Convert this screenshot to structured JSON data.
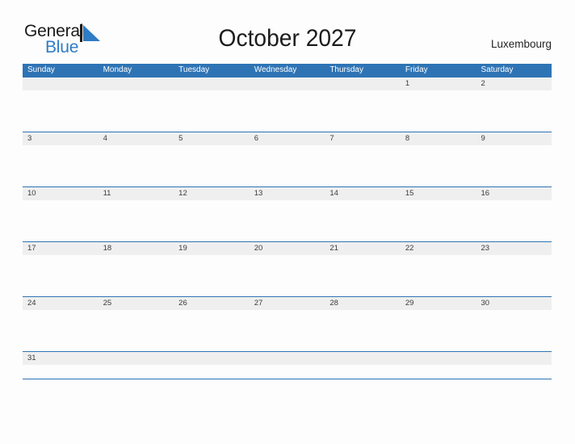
{
  "brand": {
    "name_line1": "General",
    "name_line2": "Blue",
    "triangle_icon": "triangle-right-icon",
    "color_primary": "#2e7cc4",
    "color_dark": "#1a1a1a"
  },
  "header": {
    "title": "October 2027",
    "locale": "Luxembourg"
  },
  "theme": {
    "header_blue": "#2e74b5",
    "date_strip_gray": "#efefef",
    "page_background": "#fdfdfd",
    "date_text": "#3a3a3a",
    "dow_text": "#ffffff"
  },
  "calendar": {
    "month": "October",
    "year": "2027",
    "weekday_headers": [
      "Sunday",
      "Monday",
      "Tuesday",
      "Wednesday",
      "Thursday",
      "Friday",
      "Saturday"
    ],
    "weeks": [
      {
        "days": [
          "",
          "",
          "",
          "",
          "",
          "1",
          "2"
        ]
      },
      {
        "days": [
          "3",
          "4",
          "5",
          "6",
          "7",
          "8",
          "9"
        ]
      },
      {
        "days": [
          "10",
          "11",
          "12",
          "13",
          "14",
          "15",
          "16"
        ]
      },
      {
        "days": [
          "17",
          "18",
          "19",
          "20",
          "21",
          "22",
          "23"
        ]
      },
      {
        "days": [
          "24",
          "25",
          "26",
          "27",
          "28",
          "29",
          "30"
        ]
      },
      {
        "days": [
          "31",
          "",
          "",
          "",
          "",
          "",
          ""
        ]
      }
    ]
  }
}
